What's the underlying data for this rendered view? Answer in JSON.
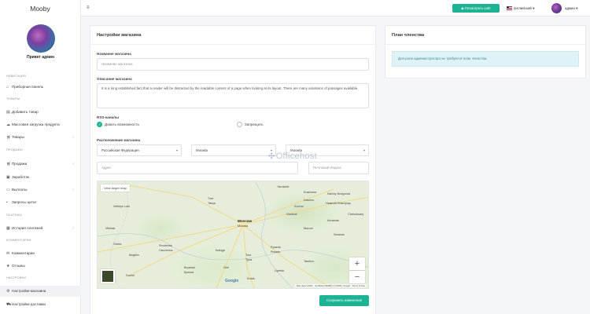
{
  "brand": "Mooby",
  "greeting": "Привет админ",
  "sidebar": {
    "sections": [
      {
        "label": "НАВИГАЦИЯ"
      },
      {
        "label": "ТОВАРЫ"
      },
      {
        "label": "ПРОДАЖИ"
      },
      {
        "label": "ПЛАТЕЖИ"
      },
      {
        "label": "КОММЕНТАРИИ"
      },
      {
        "label": "НАСТРОЙКИ"
      }
    ],
    "items": [
      {
        "label": "Приборная панель",
        "icon": "home-icon"
      },
      {
        "label": "Добавить товар",
        "icon": "file-icon"
      },
      {
        "label": "Массовая загрузка продукта",
        "icon": "upload-icon"
      },
      {
        "label": "Товары",
        "icon": "shopping-cart-icon"
      },
      {
        "label": "Продажи",
        "icon": "shopping-cart-icon"
      },
      {
        "label": "Заработок",
        "icon": "wallet-icon"
      },
      {
        "label": "Выплаты",
        "icon": "credit-card-icon"
      },
      {
        "label": "Запросы цитат",
        "icon": "money-icon"
      },
      {
        "label": "История платежей",
        "icon": "table-icon"
      },
      {
        "label": "Комментарии",
        "icon": "comments-icon"
      },
      {
        "label": "Отзывы",
        "icon": "star-icon"
      },
      {
        "label": "Настройки магазина",
        "icon": "gear-icon"
      },
      {
        "label": "Настройки доставки",
        "icon": "truck-icon"
      }
    ]
  },
  "topbar": {
    "view_site": "Посмотреть сайт",
    "language": "английский",
    "user": "админ"
  },
  "store": {
    "title": "Настройки магазина",
    "name_label": "Название магазина",
    "name_placeholder": "Название магазина",
    "desc_label": "Описание магазина",
    "desc_value": "It is a long established fact that a reader will be distracted by the readable content of a page when looking at its layout. There are many variations of passages available.",
    "rss_label": "RSS-каналы",
    "rss_on": "Давать возможность",
    "rss_off": "Запрещать",
    "location_label": "Расположение магазина",
    "country": "Российская Федерация",
    "region": "Москва",
    "city": "Москва",
    "address_placeholder": "Адрес",
    "zip_placeholder": "Почтовый Индекс",
    "save": "Сохранить изменения"
  },
  "map": {
    "larger_map": "View larger map",
    "zoom_in": "+",
    "zoom_out": "−",
    "google": "Google",
    "footer": "Map data ©2022 · GeoBasis-DE/BKG (©2009), Google · Terms of Use",
    "cities": [
      "Moscow",
      "Москва",
      "Nizhny Novgorod",
      "Нижний Новгород",
      "Smolensk",
      "Смоленск",
      "Kaluga",
      "Tula",
      "Тула",
      "Ryazan",
      "Рязань",
      "Tver",
      "Тверь",
      "Yaroslavl",
      "Vladimir",
      "Bryansk",
      "Брянск",
      "Orel",
      "Lipetsk",
      "Tambov",
      "Kostroma",
      "Ivanovo",
      "Velikiye Luki",
      "Vitebsk",
      "Gomel",
      "Orsha",
      "Kursk",
      "Saransk",
      "Cheboksary",
      "Arzamas",
      "Murom",
      "Kovrov",
      "Mogilev"
    ]
  },
  "membership": {
    "title": "План членства",
    "notice": "Для роли администратора не требуется план членства."
  },
  "watermark": "Officehost"
}
